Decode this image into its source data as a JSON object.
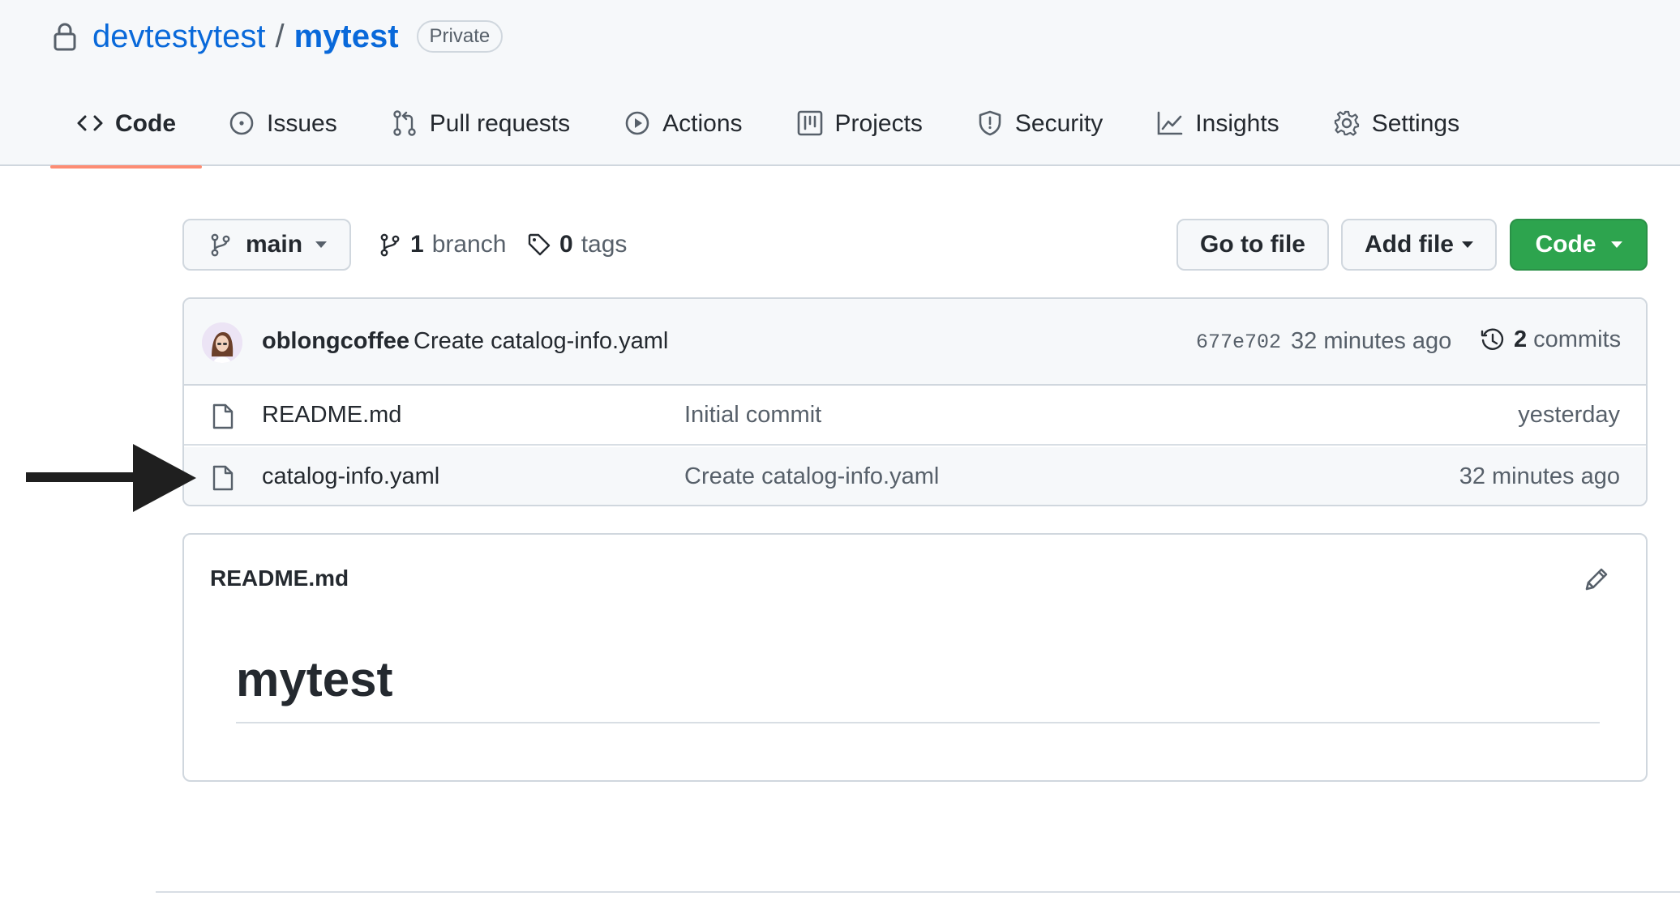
{
  "repo": {
    "owner": "devtestytest",
    "separator": "/",
    "name": "mytest",
    "visibility": "Private"
  },
  "tabs": [
    {
      "label": "Code",
      "icon": "code-icon",
      "selected": true
    },
    {
      "label": "Issues",
      "icon": "issue-icon"
    },
    {
      "label": "Pull requests",
      "icon": "pull-request-icon"
    },
    {
      "label": "Actions",
      "icon": "play-icon"
    },
    {
      "label": "Projects",
      "icon": "project-icon"
    },
    {
      "label": "Security",
      "icon": "shield-icon"
    },
    {
      "label": "Insights",
      "icon": "graph-icon"
    },
    {
      "label": "Settings",
      "icon": "gear-icon"
    }
  ],
  "toolbar": {
    "branch": "main",
    "branch_count": "1",
    "branch_word": "branch",
    "tag_count": "0",
    "tag_word": "tags",
    "goto_file": "Go to file",
    "add_file": "Add file",
    "code": "Code"
  },
  "latest_commit": {
    "author": "oblongcoffee",
    "message": "Create catalog-info.yaml",
    "sha": "677e702",
    "time": "32 minutes ago",
    "commit_count": "2",
    "commit_word": "commits"
  },
  "files": [
    {
      "name": "README.md",
      "message": "Initial commit",
      "time": "yesterday"
    },
    {
      "name": "catalog-info.yaml",
      "message": "Create catalog-info.yaml",
      "time": "32 minutes ago"
    }
  ],
  "readme": {
    "title": "README.md",
    "heading": "mytest"
  },
  "colors": {
    "accent": "#0969da",
    "tab_underline": "#fd8c73",
    "code_button": "#2da44e"
  }
}
